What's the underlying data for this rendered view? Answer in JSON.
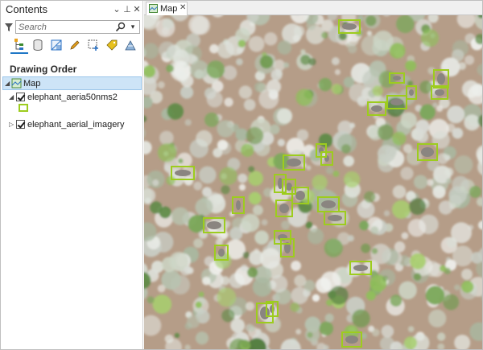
{
  "contents_pane": {
    "title": "Contents",
    "buttons": {
      "menu": "⌄",
      "pin": "⊥",
      "close": "✕"
    },
    "search_placeholder": "Search",
    "toolbar_tools": [
      "list-by-drawing-order-icon",
      "list-by-source-icon",
      "list-by-selection-icon",
      "list-by-editing-icon",
      "list-by-snapping-icon",
      "list-by-labeling-icon",
      "list-by-perspective-icon"
    ],
    "section_title": "Drawing Order",
    "tree": [
      {
        "label": "Map",
        "selected": true,
        "type": "map"
      },
      {
        "label": "elephant_aeria50nms2",
        "checked": true,
        "expanded": true,
        "type": "layer"
      },
      {
        "label": "elephant_aerial_imagery",
        "checked": true,
        "expanded": false,
        "type": "layer"
      }
    ]
  },
  "map_view": {
    "tab_label": "Map",
    "detection_box_color": "#9dcc1e",
    "detection_count": 30
  },
  "colors": {
    "selection_bg": "#cde4f7",
    "accent_blue": "#1f77c6",
    "box_green": "#9dcc1e",
    "soil": "#b49a86"
  }
}
